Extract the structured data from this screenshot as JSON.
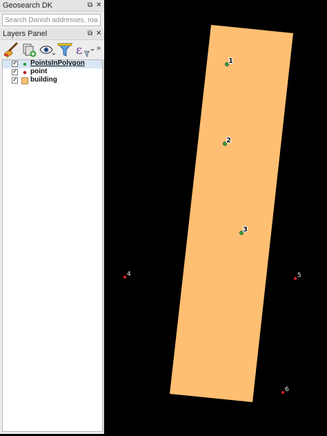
{
  "geosearch": {
    "title": "Geosearch DK",
    "float_icon": "⧉",
    "close_icon": "✕",
    "search_placeholder": "Search Danish addresses, road n..."
  },
  "layers_panel": {
    "title": "Layers Panel",
    "float_icon": "⧉",
    "close_icon": "✕",
    "more_icon": "»",
    "toolbar_icons": [
      "style-brush-icon",
      "add-group-icon",
      "eye-visibility-icon",
      "filter-icon",
      "expression-filter-icon"
    ],
    "layers": [
      {
        "name": "PointsInPolygon",
        "checked": true,
        "symbol": "point",
        "color": "#2e9e3c",
        "selected": true
      },
      {
        "name": "point",
        "checked": true,
        "symbol": "point",
        "color": "#c21e1e",
        "selected": false
      },
      {
        "name": "building",
        "checked": true,
        "symbol": "polygon",
        "color": "#ffbf73",
        "selected": false
      }
    ]
  },
  "map": {
    "background": "#000000",
    "polygon_fill": "#ffbf73",
    "inside_point_color": "#3a9f3a",
    "outside_point_color": "#d11f1f",
    "inside_labels": [
      "1",
      "2",
      "3"
    ],
    "outside_labels": [
      "4",
      "5",
      "6"
    ]
  }
}
